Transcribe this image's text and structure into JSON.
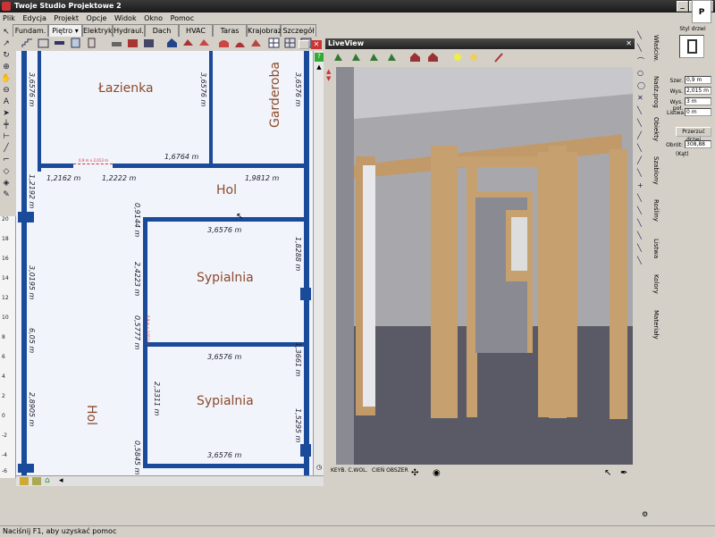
{
  "window": {
    "title": "Twoje Studio Projektowe 2",
    "min": "_",
    "max": "□",
    "close": "✕"
  },
  "menu": [
    "Plik",
    "Edycja",
    "Projekt",
    "Opcje",
    "Widok",
    "Okno",
    "Pomoc"
  ],
  "tabs": [
    "Fundam.",
    "Piętro",
    "Elektryka",
    "Hydraul.",
    "Dach",
    "HVAC",
    "Taras",
    "Krajobraz",
    "Szczegół"
  ],
  "ruler": [
    "20",
    "18",
    "16",
    "14",
    "12",
    "10",
    "8",
    "6",
    "4",
    "2",
    "0",
    "-2",
    "-4",
    "-6"
  ],
  "plan": {
    "rooms": {
      "lazienka": "Łazienka",
      "garderoba": "Garderoba",
      "hol_top": "Hol",
      "sypialnia1": "Sypialnia",
      "sypialnia2": "Sypialnia",
      "hol_left": "Hol"
    },
    "dims": {
      "d1": "3,6576 m",
      "d2": "3,6576 m",
      "d3": "3,6576 m",
      "d4": "1,6764 m",
      "d5": "1,2162 m",
      "d6": "1,2222 m",
      "d7": "1,9812 m",
      "d8": "1,2192 m",
      "d9": "0,9144 m",
      "d10": "3,6576 m",
      "d11": "1,8288 m",
      "d12": "3,0195 m",
      "d13": "2,4223 m",
      "d14": "0,5777 m",
      "d15": "6,05 m",
      "d16": "3,6576 m",
      "d17": "1,3661 m",
      "d18": "2,8905 m",
      "d19": "2,3311 m",
      "d20": "1,5295 m",
      "d21": "0,5845 m",
      "d22": "3,6576 m"
    },
    "door_label": "0,9 m x 2,013 m",
    "door_label2": "0,9 m x 2,013 m"
  },
  "liveview": {
    "title": "LiveView",
    "bottom_btn1": "KEYB. C.WOL.",
    "bottom_btn2": "CIEŃ OBSZER"
  },
  "right": {
    "vtabs": [
      "Właściw.",
      "Nadz.prog",
      "Obiekty",
      "Szablony",
      "Rośliny",
      "Listwa",
      "Kolory",
      "Materiały"
    ],
    "group_label": "Styl drzwi",
    "szer_label": "Szer.",
    "szer_value": "0,9 m",
    "wys_label": "Wys.",
    "wys_value": "2,015 m",
    "wyspol_label": "Wys. poł.",
    "wyspol_value": "3 m",
    "listwa_label": "Listwa",
    "listwa_value": "0 m",
    "przerzuc_btn": "Przerzuć drzwi",
    "obrot_label": "Obrót:",
    "obrot_value": "308,88",
    "kat_label": "(Kąt)"
  },
  "status": "Naciśnij F1, aby uzyskać pomoc",
  "colors": {
    "wall": "#1a4a9a",
    "room_text": "#8b4a2a",
    "floor": "#f2f4fb"
  }
}
